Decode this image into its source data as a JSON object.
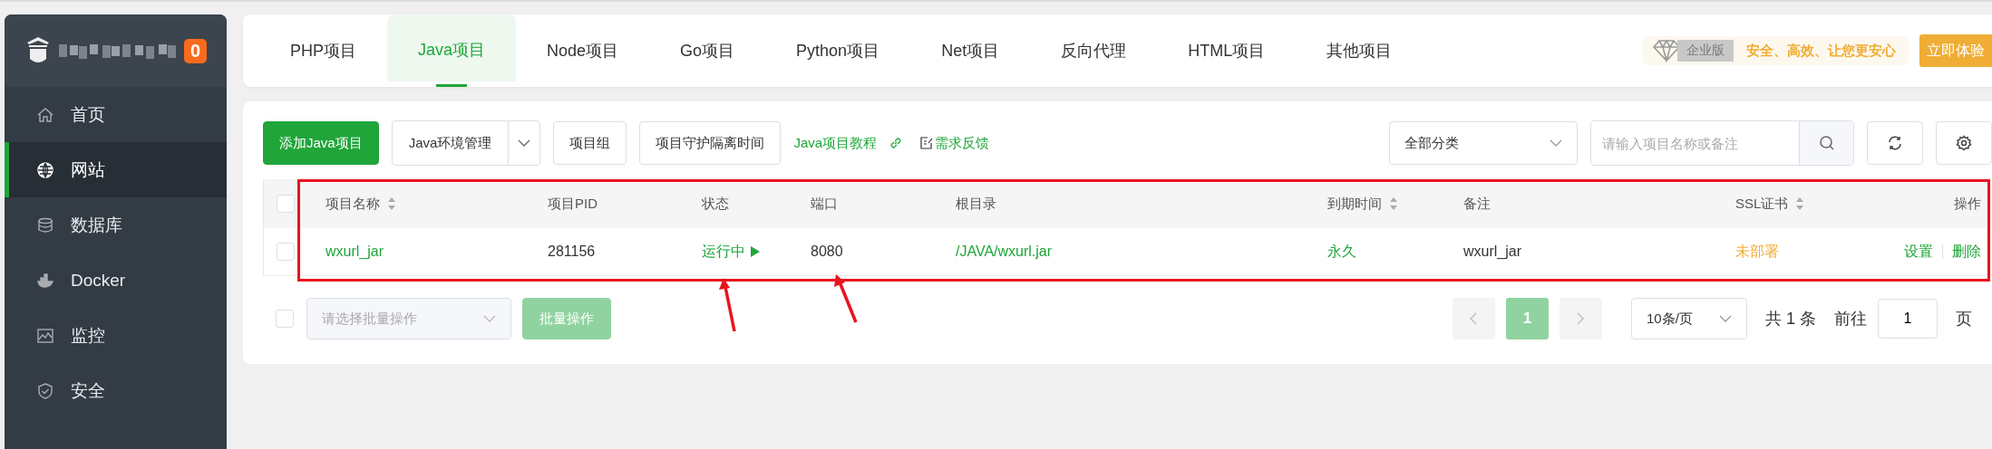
{
  "sidebar": {
    "badge": "0",
    "items": [
      {
        "label": "首页",
        "selected": false
      },
      {
        "label": "网站",
        "selected": true
      },
      {
        "label": "数据库",
        "selected": false
      },
      {
        "label": "Docker",
        "selected": false
      },
      {
        "label": "监控",
        "selected": false
      },
      {
        "label": "安全",
        "selected": false
      }
    ]
  },
  "tabs": [
    {
      "label": "PHP项目",
      "selected": false
    },
    {
      "label": "Java项目",
      "selected": true
    },
    {
      "label": "Node项目",
      "selected": false
    },
    {
      "label": "Go项目",
      "selected": false
    },
    {
      "label": "Python项目",
      "selected": false
    },
    {
      "label": "Net项目",
      "selected": false
    },
    {
      "label": "反向代理",
      "selected": false
    },
    {
      "label": "HTML项目",
      "selected": false
    },
    {
      "label": "其他项目",
      "selected": false
    }
  ],
  "promo": {
    "tag": "企业版",
    "slogan": "安全、高效、让您更安心",
    "button": "立即体验"
  },
  "toolbar": {
    "add_button": "添加Java项目",
    "env_button": "Java环境管理",
    "group_button": "项目组",
    "guard_button": "项目守护隔离时间",
    "tutorial_link": "Java项目教程",
    "feedback_link": "需求反馈",
    "category": "全部分类",
    "search": {
      "placeholder": "请输入项目名称或备注"
    }
  },
  "table": {
    "select_all_checked": false,
    "columns": [
      {
        "label": "项目名称",
        "sortable": true
      },
      {
        "label": "项目PID",
        "sortable": false
      },
      {
        "label": "状态",
        "sortable": false
      },
      {
        "label": "端口",
        "sortable": false
      },
      {
        "label": "根目录",
        "sortable": false
      },
      {
        "label": "到期时间",
        "sortable": true
      },
      {
        "label": "备注",
        "sortable": false
      },
      {
        "label": "SSL证书",
        "sortable": true
      },
      {
        "label": "操作",
        "sortable": false
      }
    ],
    "rows": [
      {
        "name": "wxurl_jar",
        "pid": "281156",
        "status": "运行中",
        "running": true,
        "port": "8080",
        "root": "/JAVA/wxurl.jar",
        "expiry": "永久",
        "remark": "wxurl_jar",
        "ssl": "未部署",
        "actions": [
          "设置",
          "删除"
        ],
        "checked": false
      }
    ]
  },
  "footer": {
    "batch_checked": false,
    "batch": {
      "placeholder": "请选择批量操作"
    },
    "batch_button": "批量操作",
    "pages": [
      {
        "label": "1",
        "selected": true
      }
    ],
    "per_page": "10条/页",
    "total": "共 1 条",
    "goto": "前往",
    "page_input": "1",
    "page_unit": "页"
  }
}
